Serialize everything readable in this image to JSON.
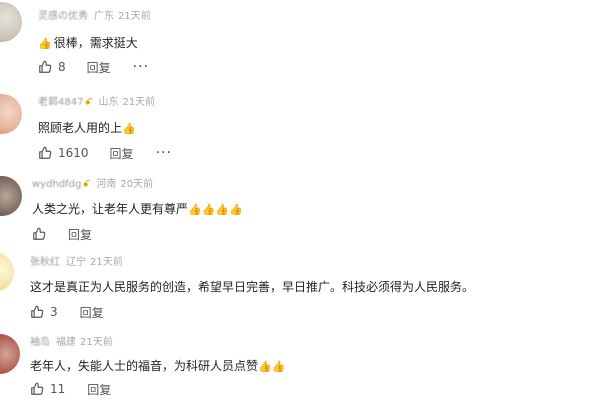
{
  "comments": [
    {
      "user": "灵感の优秀",
      "location": "广东",
      "time": "21天前",
      "verified": false,
      "text": "很棒，需求挺大",
      "thumbs": "👍",
      "likes": "8",
      "reply_label": "回复",
      "more": "···"
    },
    {
      "user": "老郭4847",
      "location": "山东",
      "time": "21天前",
      "verified": true,
      "text": "照顾老人用的上",
      "thumbs": "👍",
      "likes": "1610",
      "reply_label": "回复",
      "more": "···"
    },
    {
      "user": "wydhdfdg",
      "location": "河南",
      "time": "20天前",
      "verified": true,
      "text": "人类之光，让老年人更有尊严",
      "thumbs": "👍👍👍👍",
      "likes": "",
      "reply_label": "回复",
      "more": ""
    },
    {
      "user": "张秋红",
      "location": "辽宁",
      "time": "21天前",
      "verified": false,
      "text": "这才是真正为人民服务的创造，希望早日完善，早日推广。科技必须得为人民服务。",
      "thumbs": "",
      "likes": "3",
      "reply_label": "回复",
      "more": ""
    },
    {
      "user": "袖岛",
      "location": "福建",
      "time": "21天前",
      "verified": false,
      "text": "老年人，失能人士的福音，为科研人员点赞",
      "thumbs": "👍👍",
      "likes": "11",
      "reply_label": "回复",
      "more": ""
    }
  ],
  "colors": {
    "text": "#222222",
    "meta": "#a8a8a8",
    "action": "#555555",
    "badge": "#e0a800",
    "thumbs": "#f0b400"
  }
}
